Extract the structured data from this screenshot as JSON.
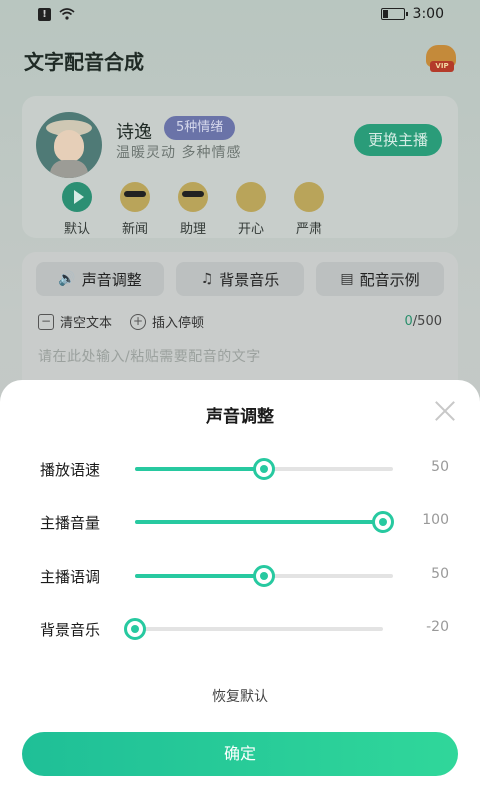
{
  "status": {
    "time": "3:00",
    "alert": "!"
  },
  "header": {
    "title": "文字配音合成",
    "vip_label": "VIP"
  },
  "voice": {
    "name": "诗逸",
    "emotion_tag": "5种情绪",
    "description": "温暖灵动  多种情感",
    "change_button": "更换主播",
    "emotions": [
      {
        "label": "默认",
        "icon": "play-icon"
      },
      {
        "label": "新闻",
        "icon": "sunglasses-emoji-icon"
      },
      {
        "label": "助理",
        "icon": "cool-emoji-icon"
      },
      {
        "label": "开心",
        "icon": "happy-emoji-icon"
      },
      {
        "label": "严肃",
        "icon": "serious-emoji-icon"
      }
    ]
  },
  "editor": {
    "tools": [
      {
        "label": "声音调整",
        "icon": "speaker-icon"
      },
      {
        "label": "背景音乐",
        "icon": "music-note-icon"
      },
      {
        "label": "配音示例",
        "icon": "document-icon"
      }
    ],
    "clear_label": "清空文本",
    "pause_label": "插入停顿",
    "count_current": "0",
    "count_max": "/500",
    "placeholder": "请在此处输入/粘贴需要配音的文字"
  },
  "sheet": {
    "title": "声音调整",
    "sliders": [
      {
        "label": "播放语速",
        "value": "50",
        "fraction": 0.5
      },
      {
        "label": "主播音量",
        "value": "100",
        "fraction": 0.96
      },
      {
        "label": "主播语调",
        "value": "50",
        "fraction": 0.5
      },
      {
        "label": "背景音乐",
        "value": "-20",
        "fraction": 0.0
      }
    ],
    "reset_label": "恢复默认",
    "confirm_label": "确定"
  },
  "colors": {
    "accent": "#27c9a0",
    "brand_green": "#2a9c79"
  }
}
